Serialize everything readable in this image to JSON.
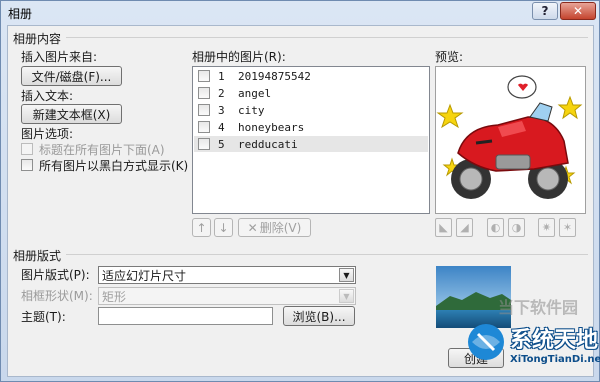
{
  "window": {
    "title": "相册",
    "help_label": "?",
    "close_label": "✕"
  },
  "content": {
    "group_title": "相册内容",
    "insert_from_label": "插入图片来自:",
    "file_disk_button": "文件/磁盘(F)...",
    "insert_text_label": "插入文本:",
    "new_textbox_button": "新建文本框(X)",
    "picture_options_label": "图片选项:",
    "captions_below_label": "标题在所有图片下面(A)",
    "black_white_label": "所有图片以黑白方式显示(K)"
  },
  "list": {
    "label": "相册中的图片(R):",
    "items": [
      {
        "num": "1",
        "name": "20194875542"
      },
      {
        "num": "2",
        "name": "angel"
      },
      {
        "num": "3",
        "name": "city"
      },
      {
        "num": "4",
        "name": "honeybears"
      },
      {
        "num": "5",
        "name": "redducati"
      }
    ],
    "selected_index": 4,
    "up_icon": "↑",
    "down_icon": "↓",
    "delete_label": "删除(V)"
  },
  "preview": {
    "label": "预览:"
  },
  "layout": {
    "group_title": "相册版式",
    "picture_layout_label": "图片版式(P):",
    "picture_layout_value": "适应幻灯片尺寸",
    "frame_shape_label": "相框形状(M):",
    "frame_shape_value": "矩形",
    "theme_label": "主题(T):",
    "theme_value": "",
    "browse_button": "浏览(B)...",
    "create_button_partial": "创建"
  },
  "watermark": {
    "site_cn": "当下软件园",
    "brand": "系统天地",
    "url": "XiTongTianDi.net"
  },
  "colors": {
    "title_bar": "#d5e1f1",
    "close_button": "#c4442e",
    "dialog_bg": "#f0f0f0"
  }
}
